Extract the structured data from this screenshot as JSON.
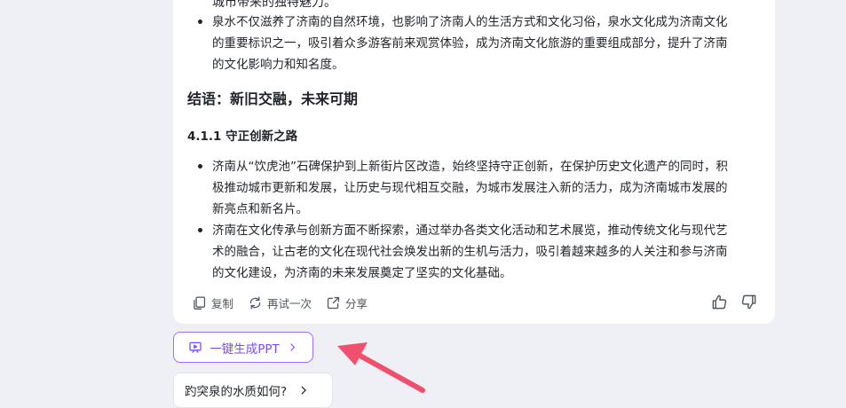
{
  "content": {
    "clipped_line": "城市带来的独特魅力。",
    "top_bullets": [
      {
        "lines": [
          "泉水不仅滋养了济南的自然环境，也影响了济南人的生活方式和文化习俗，泉水文化成为济南文化",
          "的重要标识之一，吸引着众多游客前来观赏体验，成为济南文化旅游的重要组成部分，提升了济南",
          "的文化影响力和知名度。"
        ]
      }
    ],
    "conclusion_heading": "结语：新旧交融，未来可期",
    "section_heading": "4.1.1 守正创新之路",
    "section_bullets": [
      {
        "lines": [
          "济南从“饮虎池”石碑保护到上新街片区改造，始终坚持守正创新，在保护历史文化遗产的同时，积",
          "极推动城市更新和发展，让历史与现代相互交融，为城市发展注入新的活力，成为济南城市发展的",
          "新亮点和新名片。"
        ]
      },
      {
        "lines": [
          "济南在文化传承与创新方面不断探索，通过举办各类文化活动和艺术展览，推动传统文化与现代艺",
          "术的融合，让古老的文化在现代社会焕发出新的生机与活力，吸引着越来越多的人关注和参与济南",
          "的文化建设，为济南的未来发展奠定了坚实的文化基础。"
        ]
      }
    ]
  },
  "toolbar": {
    "copy_label": "复制",
    "retry_label": "再试一次",
    "share_label": "分享",
    "copy_icon": "copy-icon",
    "retry_icon": "refresh-icon",
    "share_icon": "share-icon",
    "like_icon": "thumbs-up-icon",
    "dislike_icon": "thumbs-down-icon"
  },
  "actions": {
    "ppt_label": "一键生成PPT",
    "ppt_icon": "presentation-icon",
    "suggestion_label": "趵突泉的水质如何?"
  },
  "colors": {
    "accent": "#7c4dff",
    "annotation_arrow": "#f0506e",
    "background": "#eef0f5",
    "card": "#ffffff"
  }
}
